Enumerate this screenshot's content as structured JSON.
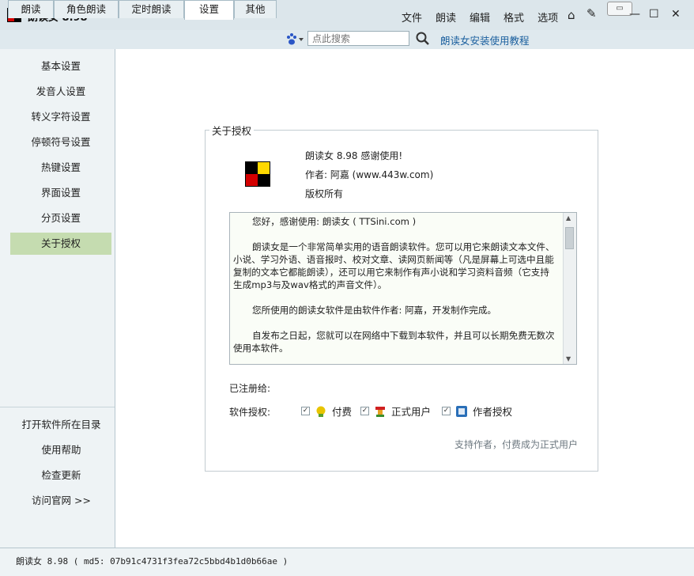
{
  "app": {
    "title": "朗读女 8.98"
  },
  "menu": [
    "文件",
    "朗读",
    "编辑",
    "格式",
    "选项"
  ],
  "tabs": [
    "朗读",
    "角色朗读",
    "定时朗读",
    "设置",
    "其他"
  ],
  "search": {
    "placeholder": "点此搜索"
  },
  "tutorial_link": "朗读女安装使用教程",
  "sidebar": {
    "items": [
      "基本设置",
      "发音人设置",
      "转义字符设置",
      "停顿符号设置",
      "热键设置",
      "界面设置",
      "分页设置",
      "关于授权"
    ],
    "bottom_items": [
      "打开软件所在目录",
      "使用帮助",
      "检查更新",
      "访问官网 >>"
    ]
  },
  "about": {
    "legend": "关于授权",
    "line1": "朗读女 8.98 感谢使用!",
    "line2": "作者: 阿嘉 (www.443w.com)",
    "line3": "版权所有",
    "paragraphs": [
      "您好，感谢使用: 朗读女 ( TTSini.com )",
      "朗读女是一个非常简单实用的语音朗读软件。您可以用它来朗读文本文件、小说、学习外语、语音报时、校对文章、读网页新闻等（凡是屏幕上可选中且能复制的文本它都能朗读），还可以用它来制作有声小说和学习资料音频（它支持生成mp3与及wav格式的声音文件）。",
      "您所使用的朗读女软件是由软件作者: 阿嘉，开发制作完成。",
      "自发布之日起，您就可以在网络中下载到本软件，并且可以长期免费无数次使用本软件。"
    ],
    "registered_label": "已注册给:",
    "license_label": "软件授权:",
    "licenses": [
      "付费",
      "正式用户",
      "作者授权"
    ],
    "support_link": "支持作者，付费成为正式用户"
  },
  "status": {
    "text": "朗读女 8.98 ( md5: 07b91c4731f3fea72c5bbd4b1d0b66ae )"
  },
  "colors": {
    "accent_link": "#1a5f9e",
    "active_sidebar": "#c5dcb0",
    "logo_yellow": "#ffd800",
    "logo_red": "#d40000"
  }
}
